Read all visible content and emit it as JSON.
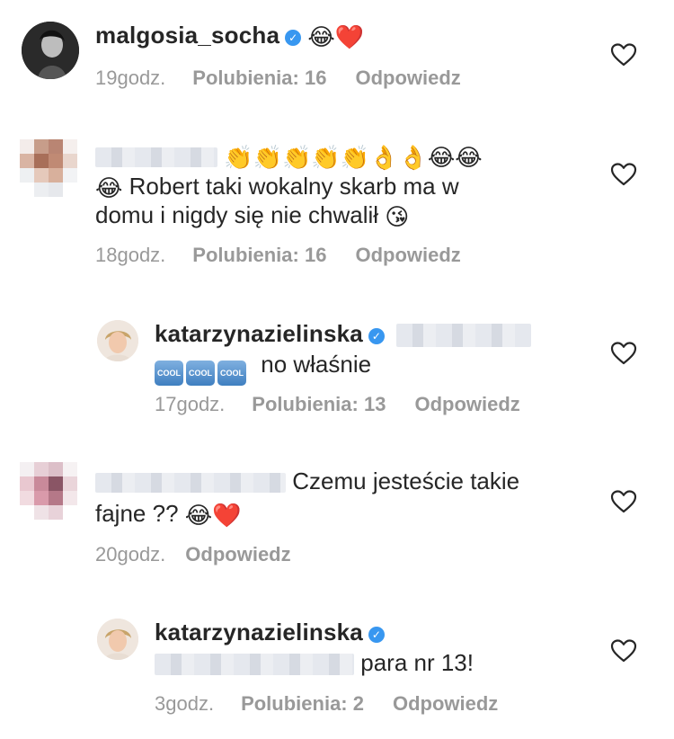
{
  "comments": [
    {
      "username": "malgosia_socha",
      "emoji": "😂❤️",
      "time": "19godz.",
      "likes_label": "Polubienia: 16",
      "reply_label": "Odpowiedz"
    },
    {
      "emoji_prefix": "👏👏👏👏👏👌👌😂😂",
      "emoji_lead": "😂",
      "line1": "Robert taki wokalny skarb ma w",
      "line2": "domu i nigdy się nie chwalił",
      "emoji_end": "😘",
      "time": "18godz.",
      "likes_label": "Polubienia: 16",
      "reply_label": "Odpowiedz"
    },
    {
      "username": "katarzynazielinska",
      "cool_badges": [
        "COOL",
        "COOL",
        "COOL"
      ],
      "text": "no właśnie",
      "time": "17godz.",
      "likes_label": "Polubienia: 13",
      "reply_label": "Odpowiedz"
    },
    {
      "text1": "Czemu jesteście takie",
      "text2": "fajne ??",
      "emoji_end": "😂❤️",
      "time": "20godz.",
      "reply_label": "Odpowiedz"
    },
    {
      "username": "katarzynazielinska",
      "text": "para nr 13!",
      "time": "3godz.",
      "likes_label": "Polubienia: 2",
      "reply_label": "Odpowiedz"
    }
  ],
  "colors": {
    "text": "#262626",
    "meta": "#999999",
    "verified": "#3897f0"
  },
  "icons": {
    "verified": "verified-badge-icon",
    "like": "heart-outline-icon"
  }
}
